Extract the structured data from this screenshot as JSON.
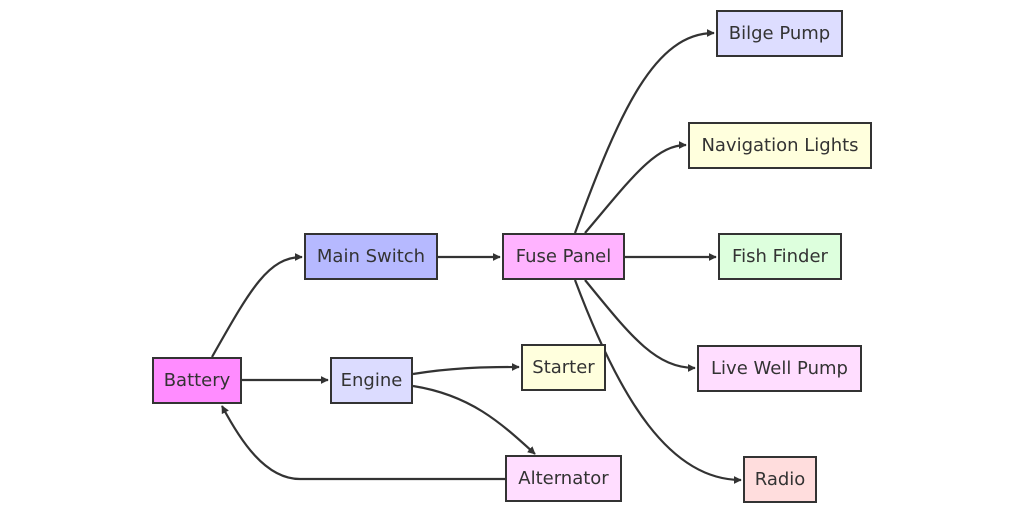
{
  "nodes": [
    {
      "id": "battery",
      "label": "Battery",
      "color": "#ff8cff"
    },
    {
      "id": "main_switch",
      "label": "Main Switch",
      "color": "#b6b9ff"
    },
    {
      "id": "fuse_panel",
      "label": "Fuse Panel",
      "color": "#ffb3ff"
    },
    {
      "id": "engine",
      "label": "Engine",
      "color": "#dcdcff"
    },
    {
      "id": "starter",
      "label": "Starter",
      "color": "#ffffdd"
    },
    {
      "id": "alternator",
      "label": "Alternator",
      "color": "#ffddff"
    },
    {
      "id": "bilge_pump",
      "label": "Bilge Pump",
      "color": "#ddddff"
    },
    {
      "id": "navigation_lights",
      "label": "Navigation Lights",
      "color": "#ffffdd"
    },
    {
      "id": "fish_finder",
      "label": "Fish Finder",
      "color": "#ddffdd"
    },
    {
      "id": "live_well_pump",
      "label": "Live Well Pump",
      "color": "#ffddff"
    },
    {
      "id": "radio",
      "label": "Radio",
      "color": "#ffdddd"
    }
  ],
  "edges": [
    {
      "from": "battery",
      "to": "main_switch"
    },
    {
      "from": "main_switch",
      "to": "fuse_panel"
    },
    {
      "from": "fuse_panel",
      "to": "bilge_pump"
    },
    {
      "from": "fuse_panel",
      "to": "navigation_lights"
    },
    {
      "from": "fuse_panel",
      "to": "fish_finder"
    },
    {
      "from": "fuse_panel",
      "to": "live_well_pump"
    },
    {
      "from": "fuse_panel",
      "to": "radio"
    },
    {
      "from": "battery",
      "to": "engine"
    },
    {
      "from": "engine",
      "to": "starter"
    },
    {
      "from": "engine",
      "to": "alternator"
    },
    {
      "from": "alternator",
      "to": "battery"
    }
  ]
}
